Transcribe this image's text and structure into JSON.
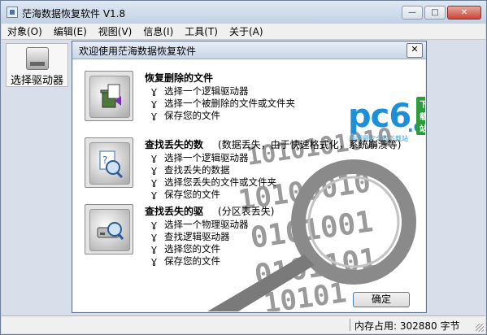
{
  "window": {
    "title": "茫海数据恢复软件 V1.8",
    "min": "—",
    "max": "□",
    "close": "✕"
  },
  "menu": [
    "对象(O)",
    "编辑(E)",
    "视图(V)",
    "信息(I)",
    "工具(T)",
    "关于(A)"
  ],
  "toolbar": {
    "select_drive_label": "选择驱动器"
  },
  "status": {
    "memory": "内存占用: 302880 字节"
  },
  "dialog": {
    "title": "欢迎使用茫海数据恢复软件",
    "close": "✕",
    "ok_label": "确定",
    "sections": [
      {
        "title": "恢复删除的文件",
        "note": "",
        "icon": "recycle-bin-icon",
        "options": [
          "选择一个逻辑驱动器",
          "选择一个被删除的文件或文件夹",
          "保存您的文件"
        ]
      },
      {
        "title": "查找丢失的数",
        "note": "(数据丢失，由于快速格式化，系统崩溃等)",
        "icon": "search-file-icon",
        "options": [
          "选择一个逻辑驱动器",
          "查找丢失的数据",
          "选择您丢失的文件或文件夹",
          "保存您的文件"
        ]
      },
      {
        "title": "查找丢失的驱",
        "note": "(分区表丢失)",
        "icon": "search-drive-icon",
        "options": [
          "选择一个物理驱动器",
          "查找逻辑驱动器",
          "选择您的文件",
          "保存您的文件"
        ]
      }
    ]
  },
  "watermark": {
    "brand": "pc6",
    "domain": ".com",
    "badge": "下载站",
    "tagline": "中国最安全的下载站"
  },
  "background_art": {
    "binary_lines": [
      "1010101010",
      "10100010",
      "0101001",
      "0101101",
      "10101"
    ]
  },
  "colors": {
    "accent": "#1c8fd8",
    "badge_green": "#2d9c3a"
  }
}
